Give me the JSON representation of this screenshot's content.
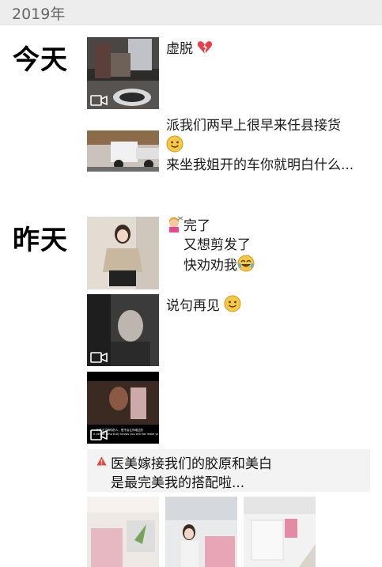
{
  "year_header": "2019年",
  "days": {
    "today": "今天",
    "yesterday": "昨天"
  },
  "posts": {
    "p1": {
      "caption": "虚脱"
    },
    "p2": {
      "line1": "派我们两早上很早来任县接货",
      "line2": "来坐我姐开的车你就明白什么..."
    },
    "p3": {
      "line1": "完了",
      "line2": "又想剪发了",
      "line3": "快劝劝我"
    },
    "p4": {
      "caption": "说句再见"
    },
    "p5": {
      "subtitle_cn": "一个真正了解你的人，是不会让你难过的",
      "subtitle_en": "A person who truly knows you will not make you sad"
    },
    "share": {
      "line1": "医美嫁接我们的胶原和美白",
      "line2": "是最完美我的搭配啦..."
    }
  },
  "icons": {
    "video": "video-camera-icon",
    "broken_heart": "broken-heart-icon",
    "smile": "smiling-face-icon",
    "haircut": "woman-haircut-icon",
    "crying_laugh": "tears-of-joy-icon",
    "warning": "red-triangle-icon"
  },
  "colors": {
    "header_bg": "#ededed",
    "share_bg": "#f3f3f3",
    "accent_red": "#e8403a"
  }
}
